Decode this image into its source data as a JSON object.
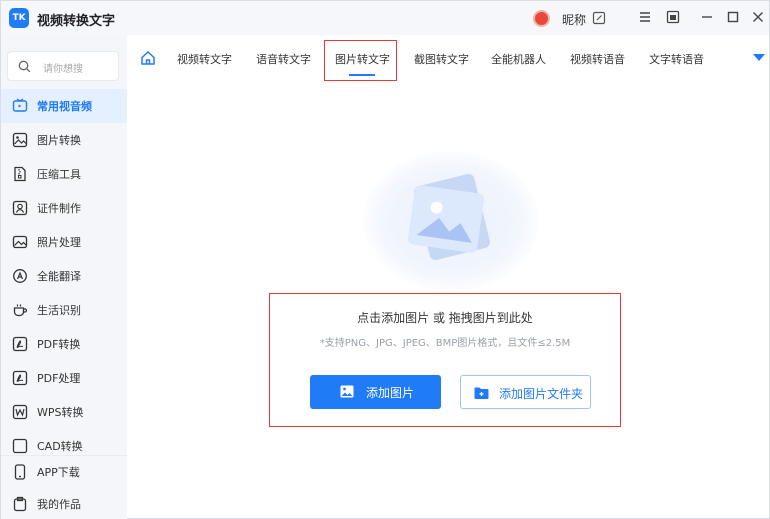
{
  "app": {
    "logo_text": "TK",
    "title": "视频转换文字",
    "nickname": "昵称"
  },
  "search": {
    "placeholder": "请你想搜"
  },
  "sidebar": {
    "items": [
      {
        "label": "常用视音频",
        "icon": "tv-icon",
        "active": true
      },
      {
        "label": "图片转换",
        "icon": "image-convert-icon"
      },
      {
        "label": "压缩工具",
        "icon": "compress-icon"
      },
      {
        "label": "证件制作",
        "icon": "id-card-icon"
      },
      {
        "label": "照片处理",
        "icon": "photo-icon"
      },
      {
        "label": "全能翻译",
        "icon": "translate-icon"
      },
      {
        "label": "生活识别",
        "icon": "cup-icon"
      },
      {
        "label": "PDF转换",
        "icon": "pdf-convert-icon"
      },
      {
        "label": "PDF处理",
        "icon": "pdf-process-icon"
      },
      {
        "label": "WPS转换",
        "icon": "wps-icon"
      },
      {
        "label": "CAD转换",
        "icon": "cad-icon"
      }
    ],
    "bottom": [
      {
        "label": "APP下载",
        "icon": "phone-icon"
      },
      {
        "label": "我的作品",
        "icon": "works-icon"
      }
    ]
  },
  "tabs": [
    {
      "label": "视频转文字"
    },
    {
      "label": "语音转文字"
    },
    {
      "label": "图片转文字",
      "active": true
    },
    {
      "label": "截图转文字"
    },
    {
      "label": "全能机器人"
    },
    {
      "label": "视频转语音"
    },
    {
      "label": "文字转语音"
    }
  ],
  "upload": {
    "title": "点击添加图片 或 拖拽图片到此处",
    "hint": "*支持PNG、JPG、JPEG、BMP图片格式，且文件≤2.5M",
    "add_button": "添加图片",
    "folder_button": "添加图片文件夹"
  },
  "colors": {
    "accent": "#1f7cf6",
    "highlight": "#e53935"
  }
}
